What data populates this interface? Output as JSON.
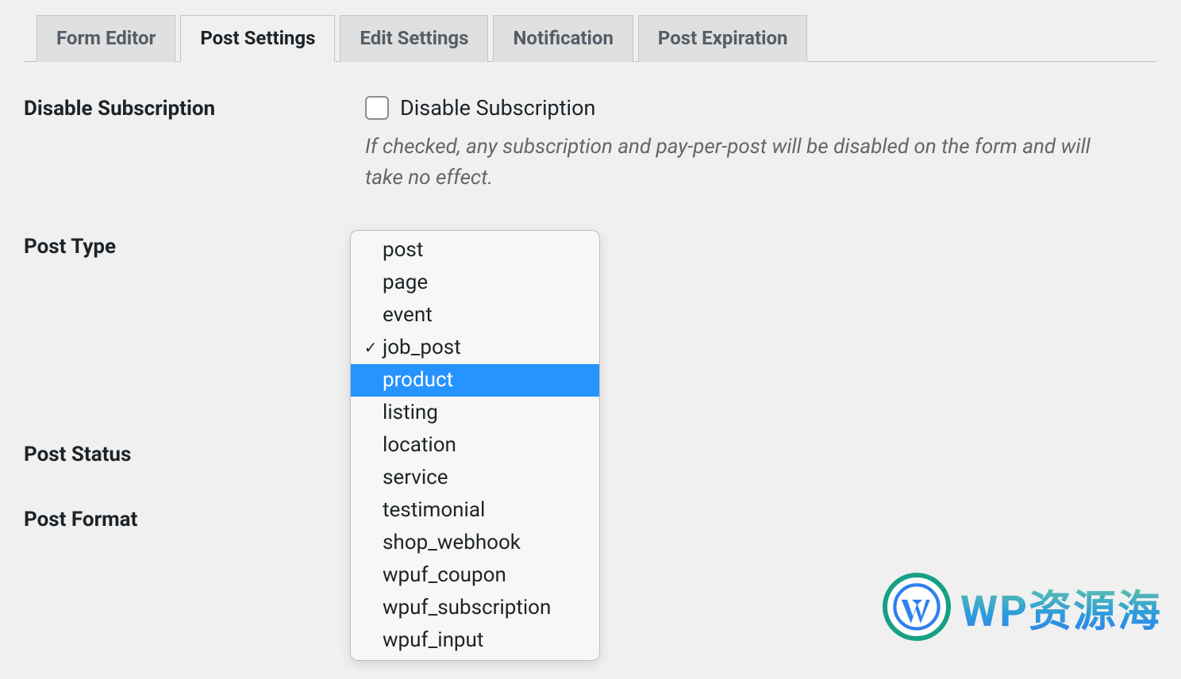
{
  "tabs": [
    {
      "label": "Form Editor",
      "active": false
    },
    {
      "label": "Post Settings",
      "active": true
    },
    {
      "label": "Edit Settings",
      "active": false
    },
    {
      "label": "Notification",
      "active": false
    },
    {
      "label": "Post Expiration",
      "active": false
    }
  ],
  "fields": {
    "disable_subscription": {
      "label": "Disable Subscription",
      "checkbox_label": "Disable Subscription",
      "checked": false,
      "help": "If checked, any subscription and pay-per-post will be disabled on the form and will take no effect."
    },
    "post_type": {
      "label": "Post Type",
      "options": [
        "post",
        "page",
        "event",
        "job_post",
        "product",
        "listing",
        "location",
        "service",
        "testimonial",
        "shop_webhook",
        "wpuf_coupon",
        "wpuf_subscription",
        "wpuf_input"
      ],
      "selected": "job_post",
      "highlighted": "product"
    },
    "post_status": {
      "label": "Post Status"
    },
    "post_format": {
      "label": "Post Format"
    }
  },
  "watermark": {
    "text": "WP资源海"
  },
  "colors": {
    "highlight": "#2693ff",
    "tab_active_bg": "#f0f0f1",
    "tab_inactive_bg": "#e0e0e0"
  }
}
